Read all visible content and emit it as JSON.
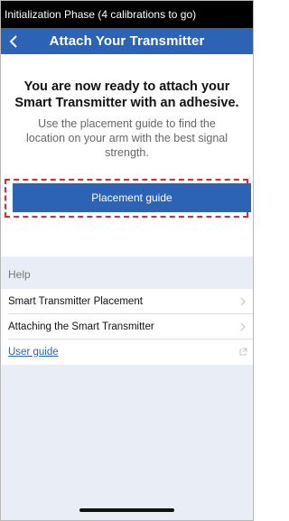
{
  "status_bar": {
    "text": "Initialization Phase (4 calibrations to go)"
  },
  "nav": {
    "title": "Attach Your Transmitter",
    "back_icon": "chevron-left-icon"
  },
  "main": {
    "headline": "You are now ready to attach your Smart Transmitter with an adhesive.",
    "subtext": "Use the placement guide to find the location on your arm with the best signal strength.",
    "placement_button_label": "Placement guide"
  },
  "help": {
    "header": "Help",
    "items": [
      {
        "label": "Smart Transmitter Placement",
        "icon": "chevron-right-icon"
      },
      {
        "label": "Attaching the Smart Transmitter",
        "icon": "chevron-right-icon"
      },
      {
        "label": "User guide",
        "icon": "external-link-icon"
      }
    ]
  },
  "colors": {
    "brand_blue": "#2d63b4",
    "highlight_red": "#e3262b",
    "background": "#e9eef6"
  }
}
